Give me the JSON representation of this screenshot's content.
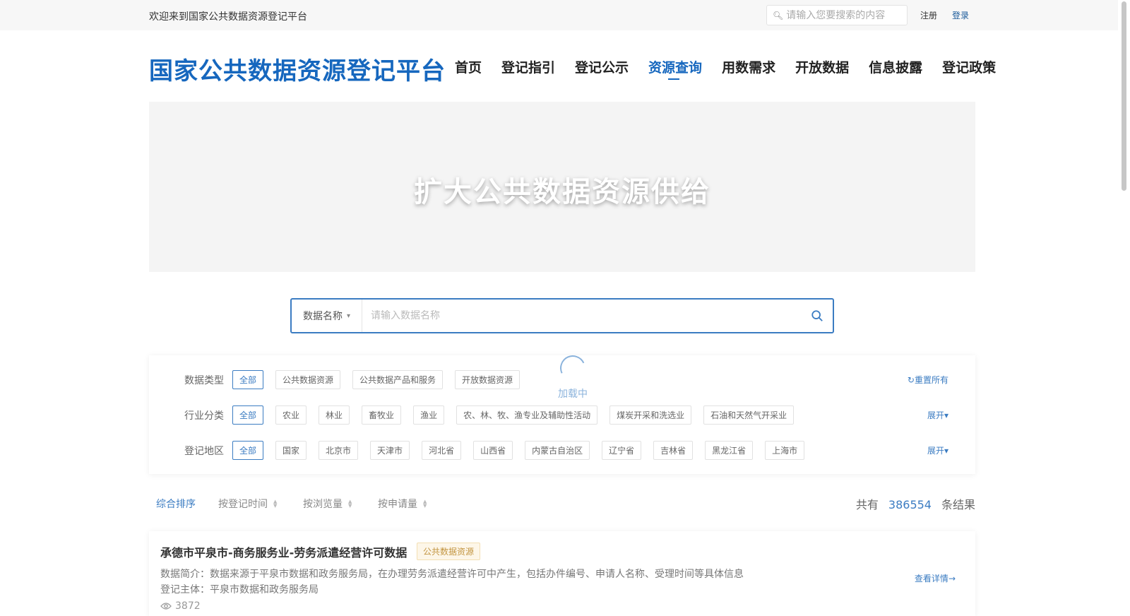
{
  "topbar": {
    "welcome": "欢迎来到国家公共数据资源登记平台",
    "search_placeholder": "请输入您要搜索的内容",
    "register": "注册",
    "login": "登录"
  },
  "header": {
    "logo": "国家公共数据资源登记平台",
    "nav": [
      "首页",
      "登记指引",
      "登记公示",
      "资源查询",
      "用数需求",
      "开放数据",
      "信息披露",
      "登记政策"
    ],
    "active_nav": "资源查询"
  },
  "banner": {
    "text": "扩大公共数据资源供给"
  },
  "search": {
    "field_label": "数据名称",
    "placeholder": "请输入数据名称"
  },
  "filters": {
    "loading_text": "加载中",
    "reset_all": "重置所有",
    "expand": "展开",
    "rows": [
      {
        "label": "数据类型",
        "tags": [
          "全部",
          "公共数据资源",
          "公共数据产品和服务",
          "开放数据资源"
        ]
      },
      {
        "label": "行业分类",
        "tags": [
          "全部",
          "农业",
          "林业",
          "畜牧业",
          "渔业",
          "农、林、牧、渔专业及辅助性活动",
          "煤炭开采和洗选业",
          "石油和天然气开采业"
        ]
      },
      {
        "label": "登记地区",
        "tags": [
          "全部",
          "国家",
          "北京市",
          "天津市",
          "河北省",
          "山西省",
          "内蒙古自治区",
          "辽宁省",
          "吉林省",
          "黑龙江省",
          "上海市"
        ]
      }
    ]
  },
  "sort": {
    "options": [
      "综合排序",
      "按登记时间",
      "按浏览量",
      "按申请量"
    ],
    "total_prefix": "共有",
    "total_count": "386554",
    "total_suffix": "条结果"
  },
  "results": [
    {
      "title": "承德市平泉市-商务服务业-劳务派遣经营许可数据",
      "tag": "公共数据资源",
      "desc": "数据简介：数据来源于平泉市数据和政务服务局，在办理劳务派遣经营许可中产生，包括办件编号、申请人名称、受理时间等具体信息",
      "owner": "登记主体：平泉市数据和政务服务局",
      "views": "3872",
      "detail": "查看详情"
    }
  ],
  "colors": {
    "brand": "#1667be",
    "accent": "#3b7cc2",
    "tag_gold": "#c39541"
  }
}
